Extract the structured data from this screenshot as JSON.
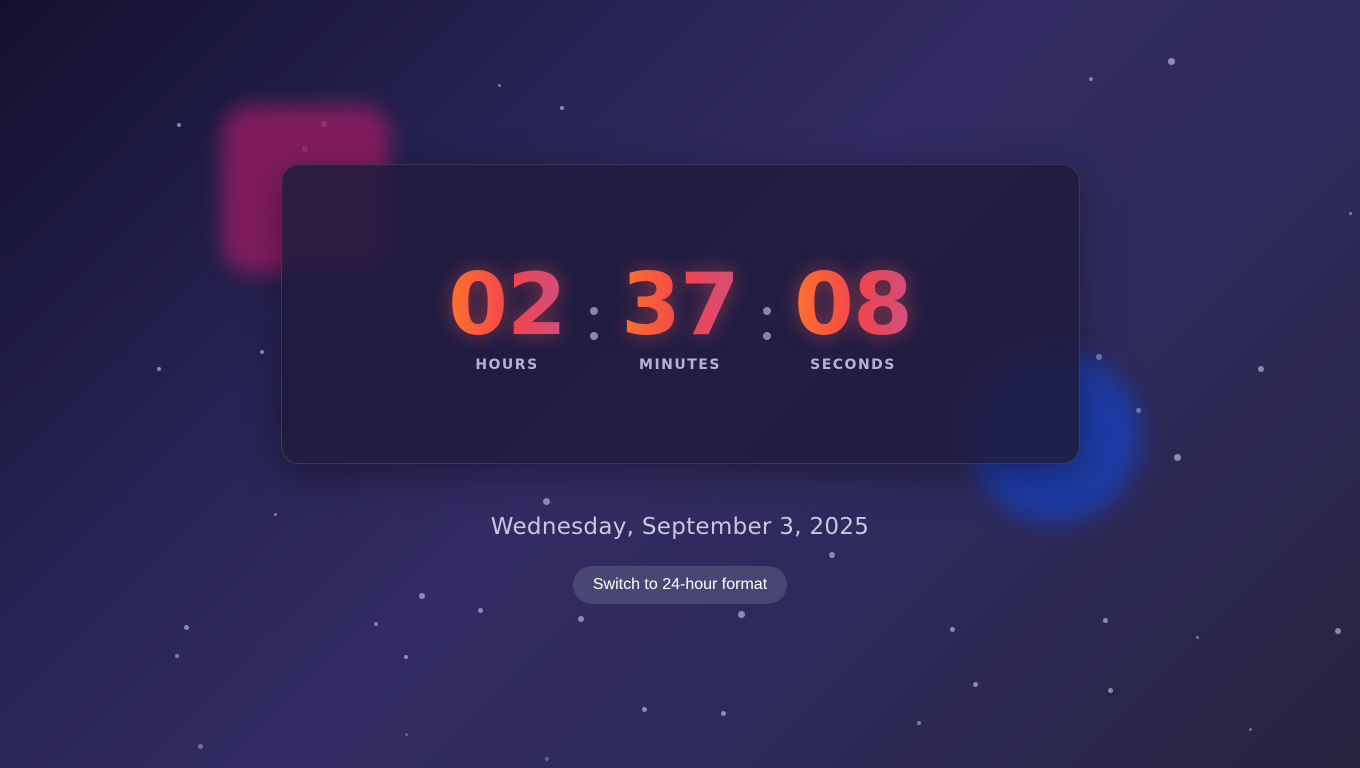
{
  "clock": {
    "hours": "02",
    "minutes": "37",
    "seconds": "08",
    "hours_label": "HOURS",
    "minutes_label": "MINUTES",
    "seconds_label": "SECONDS"
  },
  "date_text": "Wednesday, September 3, 2025",
  "format_toggle_label": "Switch to 24-hour format",
  "colors": {
    "digit_gradient_start": "#ff7a26",
    "digit_gradient_mid": "#f1434f",
    "digit_gradient_end": "#c85388",
    "background_dark": "#13102e",
    "background_mid": "#322b64",
    "pink_blob": "#9a1c63",
    "blue_blob": "#1b3fb4"
  }
}
